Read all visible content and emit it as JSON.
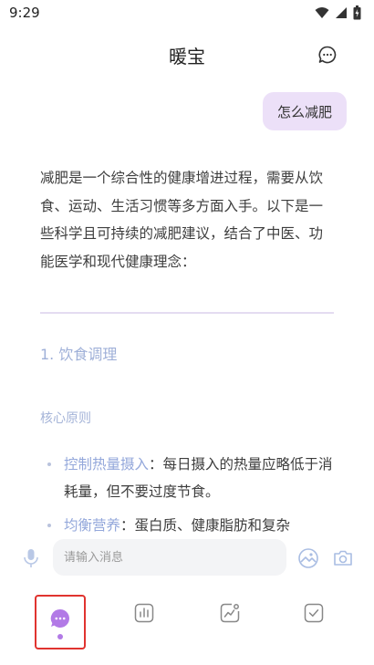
{
  "status_bar": {
    "time": "9:29"
  },
  "header": {
    "title": "暖宝"
  },
  "messages": {
    "user": "怎么减肥",
    "reply_intro": "减肥是一个综合性的健康增进过程，需要从饮食、运动、生活习惯等多方面入手。以下是一些科学且可持续的减肥建议，结合了中医、功能医学和现代健康理念：",
    "section_title": "1. 饮食调理",
    "subsection_title": "核心原则",
    "bullets": [
      {
        "term": "控制热量摄入",
        "sep": "：",
        "text": "每日摄入的热量应略低于消耗量，但不要过度节食。"
      },
      {
        "term": "均衡营养",
        "sep": "：",
        "text": "蛋白质、健康脂肪和复杂"
      }
    ]
  },
  "input": {
    "placeholder": "请输入消息"
  },
  "icons": {
    "chat": "chat-bubble-icon",
    "mic": "microphone-icon",
    "image": "image-icon",
    "camera": "camera-icon",
    "tabs": [
      "chat-icon",
      "bar-chart-icon",
      "trend-chart-icon",
      "checkbox-icon"
    ]
  },
  "colors": {
    "accent": "#b27ae6",
    "bubble": "#ece0f8",
    "link": "#94a8db",
    "highlight_border": "#e0332f"
  }
}
